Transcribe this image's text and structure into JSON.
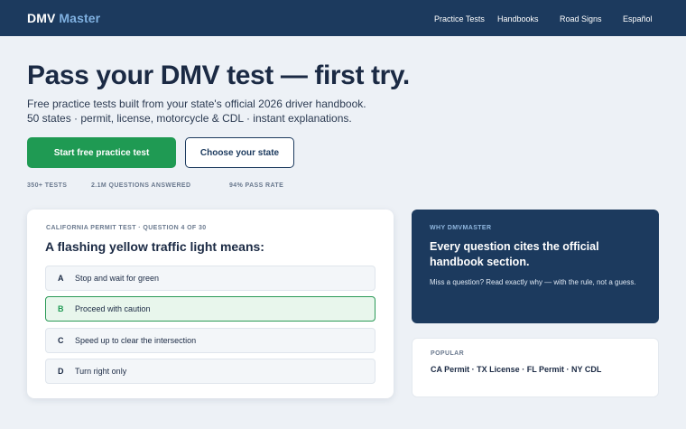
{
  "header": {
    "logo_primary": "DMV",
    "logo_accent": "Master",
    "nav": [
      "Practice Tests",
      "Handbooks",
      "Road Signs",
      "Español"
    ]
  },
  "hero": {
    "title": "Pass your DMV test — first try.",
    "subtitle_line1": "Free practice tests built from your state's official 2026 driver handbook.",
    "subtitle_line2": "50 states · permit, license, motorcycle & CDL · instant explanations.",
    "cta_primary": "Start free practice test",
    "cta_secondary": "Choose your state",
    "stats": [
      "350+ TESTS",
      "2.1M QUESTIONS ANSWERED",
      "94% PASS RATE"
    ]
  },
  "quiz": {
    "meta": "CALIFORNIA PERMIT TEST · QUESTION 4 OF 30",
    "question": "A flashing yellow traffic light means:",
    "options": [
      {
        "letter": "A",
        "text": "Stop and wait for green",
        "selected": false
      },
      {
        "letter": "B",
        "text": "Proceed with caution",
        "selected": true
      },
      {
        "letter": "C",
        "text": "Speed up to clear the intersection",
        "selected": false
      },
      {
        "letter": "D",
        "text": "Turn right only",
        "selected": false
      }
    ]
  },
  "why": {
    "kicker": "WHY DMVMASTER",
    "title": "Every question cites the official handbook section.",
    "body": "Miss a question? Read exactly why — with the rule, not a guess."
  },
  "popular": {
    "kicker": "POPULAR",
    "links": "CA Permit · TX License · FL Permit · NY CDL"
  },
  "colors": {
    "navy": "#1c3a5e",
    "accent_green": "#1f9a53",
    "background": "#edf1f6"
  }
}
